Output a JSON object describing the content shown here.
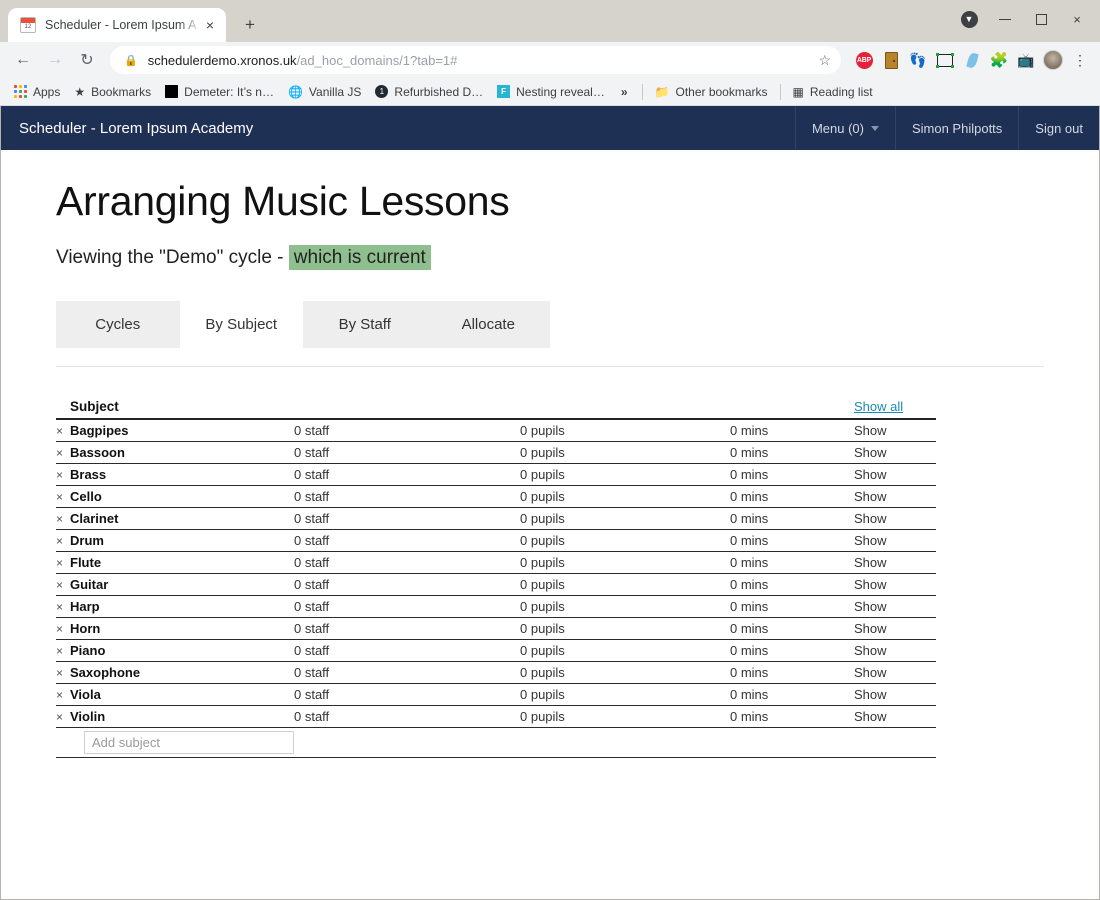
{
  "browser": {
    "tab": {
      "title": "Scheduler - Lorem Ipsum A",
      "favicon_name": "calendar-favicon",
      "favicon_text": "12",
      "close_label": "×"
    },
    "new_tab_label": "+",
    "window_controls": {
      "extension_badge": "▼",
      "minimize": "",
      "maximize": "",
      "close": "×"
    },
    "toolbar": {
      "back": "←",
      "forward": "→",
      "reload": "↻",
      "lock": "🔒",
      "url_host": "schedulerdemo.xronos.uk",
      "url_path": "/ad_hoc_domains/1?tab=1#",
      "star": "☆",
      "extensions": [
        {
          "name": "adblock-plus-icon",
          "label": "ABP"
        },
        {
          "name": "vault-door-icon",
          "label": ""
        },
        {
          "name": "gnome-foot-icon",
          "label": "👣"
        },
        {
          "name": "screenshot-frame-icon",
          "label": ""
        },
        {
          "name": "leaf-icon",
          "label": ""
        },
        {
          "name": "puzzle-extensions-icon",
          "label": "🧩"
        },
        {
          "name": "cast-icon",
          "label": "📺"
        }
      ],
      "profile_name": "profile-avatar",
      "menu": "⋮"
    },
    "bookmarks": [
      {
        "label": "Apps",
        "icon": "apps-grid-icon"
      },
      {
        "label": "Bookmarks",
        "icon": "star-icon"
      },
      {
        "label": "Demeter: It’s n…",
        "icon": "black-square-icon"
      },
      {
        "label": "Vanilla JS",
        "icon": "globe-icon"
      },
      {
        "label": "Refurbished D…",
        "icon": "dark-circle-icon"
      },
      {
        "label": "Nesting reveal…",
        "icon": "cyan-square-icon"
      }
    ],
    "bookmarks_overflow": "»",
    "other_bookmarks": {
      "label": "Other bookmarks",
      "icon": "folder-icon"
    },
    "reading_list": {
      "label": "Reading list",
      "icon": "reading-list-icon"
    }
  },
  "app": {
    "navbar": {
      "brand": "Scheduler - Lorem Ipsum Academy",
      "menu_label": "Menu (0)",
      "user_name": "Simon Philpotts",
      "sign_out": "Sign out"
    },
    "page_title": "Arranging Music Lessons",
    "subtitle_prefix": "Viewing the \"Demo\" cycle - ",
    "subtitle_highlight": "which is current",
    "highlight_color": "#8fbf8f",
    "tabs": [
      {
        "label": "Cycles",
        "active": false
      },
      {
        "label": "By Subject",
        "active": true
      },
      {
        "label": "By Staff",
        "active": false
      },
      {
        "label": "Allocate",
        "active": false
      }
    ],
    "table": {
      "header": {
        "subject": "Subject",
        "staff": "",
        "pupils": "",
        "mins": "",
        "show_all": "Show all"
      },
      "delete_mark": "×",
      "show_label": "Show",
      "rows": [
        {
          "subject": "Bagpipes",
          "staff": "0 staff",
          "pupils": "0 pupils",
          "mins": "0 mins"
        },
        {
          "subject": "Bassoon",
          "staff": "0 staff",
          "pupils": "0 pupils",
          "mins": "0 mins"
        },
        {
          "subject": "Brass",
          "staff": "0 staff",
          "pupils": "0 pupils",
          "mins": "0 mins"
        },
        {
          "subject": "Cello",
          "staff": "0 staff",
          "pupils": "0 pupils",
          "mins": "0 mins"
        },
        {
          "subject": "Clarinet",
          "staff": "0 staff",
          "pupils": "0 pupils",
          "mins": "0 mins"
        },
        {
          "subject": "Drum",
          "staff": "0 staff",
          "pupils": "0 pupils",
          "mins": "0 mins"
        },
        {
          "subject": "Flute",
          "staff": "0 staff",
          "pupils": "0 pupils",
          "mins": "0 mins"
        },
        {
          "subject": "Guitar",
          "staff": "0 staff",
          "pupils": "0 pupils",
          "mins": "0 mins"
        },
        {
          "subject": "Harp",
          "staff": "0 staff",
          "pupils": "0 pupils",
          "mins": "0 mins"
        },
        {
          "subject": "Horn",
          "staff": "0 staff",
          "pupils": "0 pupils",
          "mins": "0 mins"
        },
        {
          "subject": "Piano",
          "staff": "0 staff",
          "pupils": "0 pupils",
          "mins": "0 mins"
        },
        {
          "subject": "Saxophone",
          "staff": "0 staff",
          "pupils": "0 pupils",
          "mins": "0 mins"
        },
        {
          "subject": "Viola",
          "staff": "0 staff",
          "pupils": "0 pupils",
          "mins": "0 mins"
        },
        {
          "subject": "Violin",
          "staff": "0 staff",
          "pupils": "0 pupils",
          "mins": "0 mins"
        }
      ],
      "add_placeholder": "Add subject",
      "add_value": ""
    }
  }
}
